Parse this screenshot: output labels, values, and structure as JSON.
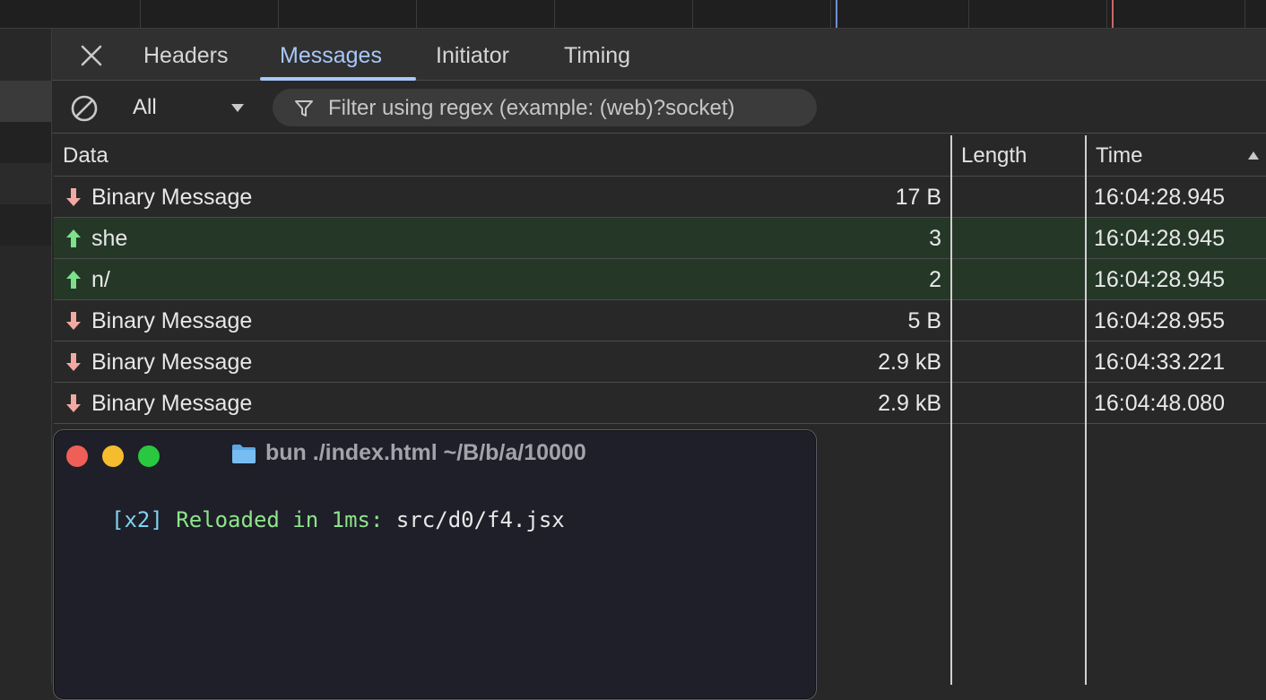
{
  "tabs": [
    {
      "label": "Headers",
      "active": false
    },
    {
      "label": "Messages",
      "active": true
    },
    {
      "label": "Initiator",
      "active": false
    },
    {
      "label": "Timing",
      "active": false
    }
  ],
  "toolbar": {
    "filter_type": "All",
    "filter_placeholder": "Filter using regex (example: (web)?socket)"
  },
  "table": {
    "headers": {
      "data": "Data",
      "length": "Length",
      "time": "Time"
    },
    "sort": "Time ascending",
    "rows": [
      {
        "direction": "received",
        "data": "Binary Message",
        "length": "17 B",
        "time": "16:04:28.945"
      },
      {
        "direction": "sent",
        "data": "she",
        "length": "3",
        "time": "16:04:28.945"
      },
      {
        "direction": "sent",
        "data": "n/",
        "length": "2",
        "time": "16:04:28.945"
      },
      {
        "direction": "received",
        "data": "Binary Message",
        "length": "5 B",
        "time": "16:04:28.955"
      },
      {
        "direction": "received",
        "data": "Binary Message",
        "length": "2.9 kB",
        "time": "16:04:33.221"
      },
      {
        "direction": "received",
        "data": "Binary Message",
        "length": "2.9 kB",
        "time": "16:04:48.080"
      }
    ]
  },
  "terminal": {
    "title": "bun  ./index.html ~/B/b/a/10000",
    "line_prefix": "[x2]",
    "line_message": "Reloaded in 1ms:",
    "line_path": "src/d0/f4.jsx"
  },
  "colors": {
    "accent": "#a8c7fa",
    "sent_row_bg": "#253827",
    "sent_arrow": "#7ee08a",
    "received_arrow": "#f2a9a3",
    "terminal_bg": "#1e1f29"
  },
  "icons": {
    "close": "close-icon",
    "clear": "clear-icon",
    "filter": "funnel-icon",
    "sent": "arrow-up-icon",
    "received": "arrow-down-icon",
    "folder": "folder-icon"
  }
}
